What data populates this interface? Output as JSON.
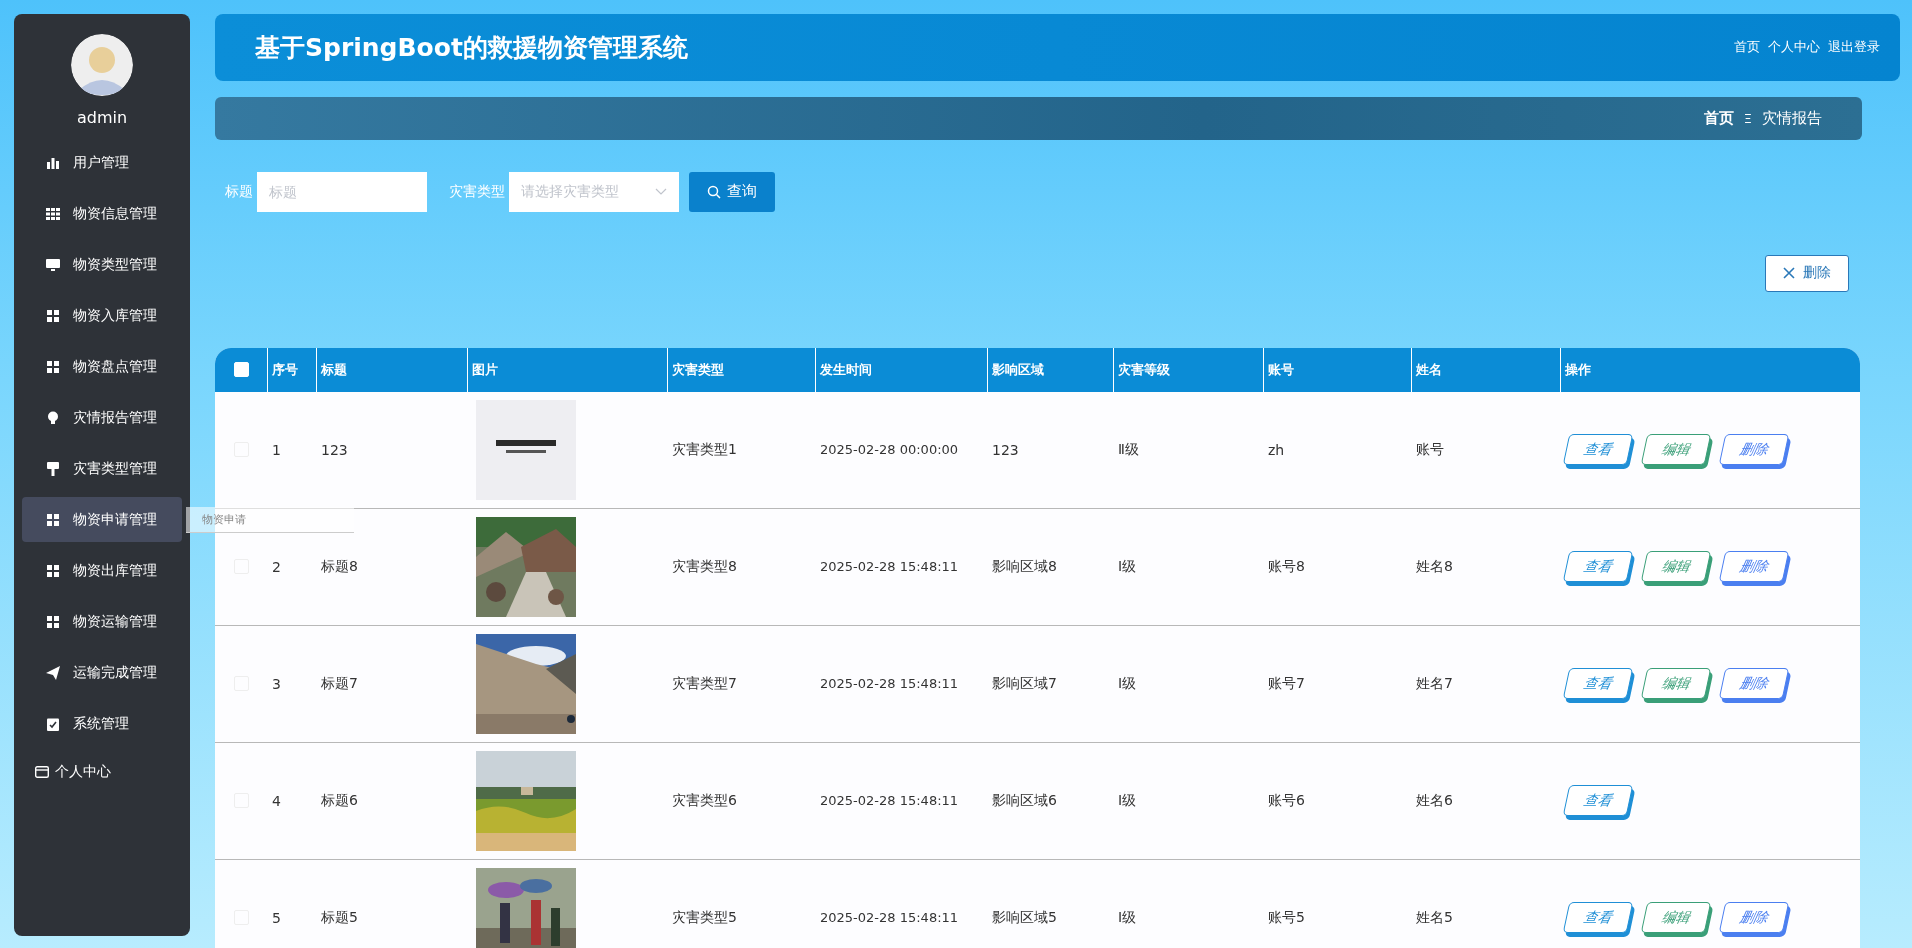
{
  "sidebar": {
    "user": {
      "name": "admin"
    },
    "items": [
      {
        "label": "用户管理",
        "hovered": false
      },
      {
        "label": "物资信息管理",
        "hovered": false
      },
      {
        "label": "物资类型管理",
        "hovered": false
      },
      {
        "label": "物资入库管理",
        "hovered": false
      },
      {
        "label": "物资盘点管理",
        "hovered": false
      },
      {
        "label": "灾情报告管理",
        "hovered": false
      },
      {
        "label": "灾害类型管理",
        "hovered": false
      },
      {
        "label": "物资申请管理",
        "hovered": true
      },
      {
        "label": "物资出库管理",
        "hovered": false
      },
      {
        "label": "物资运输管理",
        "hovered": false
      },
      {
        "label": "运输完成管理",
        "hovered": false
      },
      {
        "label": "系统管理",
        "hovered": false
      }
    ],
    "profile_item": {
      "label": "个人中心"
    },
    "tooltip": "物资申请"
  },
  "header": {
    "title": "基于SpringBoot的救援物资管理系统",
    "links": [
      "首页",
      "个人中心",
      "退出登录"
    ]
  },
  "breadcrumb": {
    "items": [
      "首页",
      "灾情报告"
    ],
    "separator": "Ξ"
  },
  "search": {
    "fields": [
      {
        "label": "标题",
        "placeholder": "标题",
        "kind": "input"
      },
      {
        "label": "灾害类型",
        "placeholder": "请选择灾害类型",
        "kind": "select"
      }
    ],
    "button": "查询"
  },
  "delete_button": "删除",
  "table": {
    "select_all": {
      "checked": false
    },
    "columns": [
      "序号",
      "标题",
      "图片",
      "灾害类型",
      "发生时间",
      "影响区域",
      "灾害等级",
      "账号",
      "姓名",
      "操作"
    ],
    "rows": [
      {
        "checked": false,
        "cells": [
          "1",
          "123",
          "",
          "灾害类型1",
          "2025-02-28 00:00:00",
          "123",
          "Ⅱ级",
          "zh",
          "账号"
        ],
        "actions": [
          {
            "label": "查看",
            "kind": "view"
          },
          {
            "label": "编辑",
            "kind": "edit"
          },
          {
            "label": "删除",
            "kind": "delete"
          }
        ]
      },
      {
        "checked": false,
        "cells": [
          "2",
          "标题8",
          "",
          "灾害类型8",
          "2025-02-28 15:48:11",
          "影响区域8",
          "Ⅰ级",
          "账号8",
          "姓名8"
        ],
        "actions": [
          {
            "label": "查看",
            "kind": "view"
          },
          {
            "label": "编辑",
            "kind": "edit"
          },
          {
            "label": "删除",
            "kind": "delete"
          }
        ]
      },
      {
        "checked": false,
        "cells": [
          "3",
          "标题7",
          "",
          "灾害类型7",
          "2025-02-28 15:48:11",
          "影响区域7",
          "Ⅰ级",
          "账号7",
          "姓名7"
        ],
        "actions": [
          {
            "label": "查看",
            "kind": "view"
          },
          {
            "label": "编辑",
            "kind": "edit"
          },
          {
            "label": "删除",
            "kind": "delete"
          }
        ]
      },
      {
        "checked": false,
        "cells": [
          "4",
          "标题6",
          "",
          "灾害类型6",
          "2025-02-28 15:48:11",
          "影响区域6",
          "Ⅰ级",
          "账号6",
          "姓名6"
        ],
        "actions": [
          {
            "label": "查看",
            "kind": "view"
          }
        ]
      },
      {
        "checked": false,
        "cells": [
          "5",
          "标题5",
          "",
          "灾害类型5",
          "2025-02-28 15:48:11",
          "影响区域5",
          "Ⅰ级",
          "账号5",
          "姓名5"
        ],
        "actions": [
          {
            "label": "查看",
            "kind": "view"
          },
          {
            "label": "编辑",
            "kind": "edit"
          },
          {
            "label": "删除",
            "kind": "delete"
          }
        ]
      }
    ]
  }
}
